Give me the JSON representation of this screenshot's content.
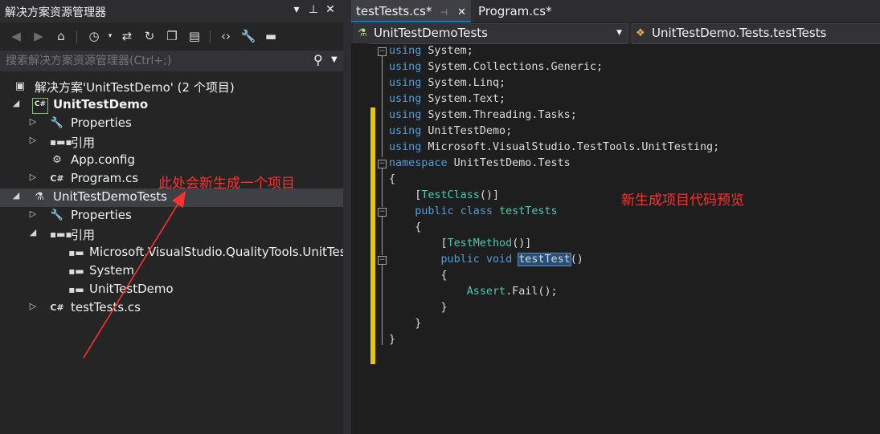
{
  "solution_explorer": {
    "title": "解决方案资源管理器",
    "title_buttons": [
      "▾",
      "⊥",
      "✕"
    ],
    "search_placeholder": "搜索解决方案资源管理器(Ctrl+;)",
    "tree": [
      {
        "label": "解决方案'UnitTestDemo' (2 个项目)",
        "icon": "solution-icon"
      },
      {
        "label": "UnitTestDemo",
        "icon": "csharp-project-icon"
      },
      {
        "label": "Properties",
        "icon": "wrench-icon"
      },
      {
        "label": "引用",
        "icon": "references-icon"
      },
      {
        "label": "App.config",
        "icon": "config-file-icon"
      },
      {
        "label": "Program.cs",
        "icon": "csharp-file-icon"
      },
      {
        "label": "UnitTestDemoTests",
        "icon": "test-project-icon"
      },
      {
        "label": "Properties",
        "icon": "wrench-icon"
      },
      {
        "label": "引用",
        "icon": "references-icon"
      },
      {
        "label": "Microsoft.VisualStudio.QualityTools.UnitTestFramework",
        "icon": "reference-icon"
      },
      {
        "label": "System",
        "icon": "reference-icon"
      },
      {
        "label": "UnitTestDemo",
        "icon": "reference-icon"
      },
      {
        "label": "testTests.cs",
        "icon": "csharp-file-icon"
      }
    ]
  },
  "annotations": {
    "left": "此处会新生成一个项目",
    "right": "新生成项目代码预览",
    "accent_color": "#ff3030"
  },
  "editor": {
    "tabs": [
      {
        "label": "testTests.cs*",
        "active": true
      },
      {
        "label": "Program.cs*",
        "active": false
      }
    ],
    "nav_left": "UnitTestDemoTests",
    "nav_right": "UnitTestDemo.Tests.testTests",
    "code_lines": [
      [
        [
          "kw",
          "using"
        ],
        [
          "t",
          " System;"
        ]
      ],
      [
        [
          "kw",
          "using"
        ],
        [
          "t",
          " System.Collections.Generic;"
        ]
      ],
      [
        [
          "kw",
          "using"
        ],
        [
          "t",
          " System.Linq;"
        ]
      ],
      [
        [
          "kw",
          "using"
        ],
        [
          "t",
          " System.Text;"
        ]
      ],
      [
        [
          "kw",
          "using"
        ],
        [
          "t",
          " System.Threading.Tasks;"
        ]
      ],
      [
        [
          "kw",
          "using"
        ],
        [
          "t",
          " UnitTestDemo;"
        ]
      ],
      [
        [
          "kw",
          "using"
        ],
        [
          "t",
          " Microsoft.VisualStudio.TestTools.UnitTesting;"
        ]
      ],
      [
        [
          "kw",
          "namespace"
        ],
        [
          "t",
          " UnitTestDemo.Tests"
        ]
      ],
      [
        [
          "t",
          "{"
        ]
      ],
      [
        [
          "t",
          "    ["
        ],
        [
          "ty",
          "TestClass"
        ],
        [
          "t",
          "()]"
        ]
      ],
      [
        [
          "t",
          "    "
        ],
        [
          "kw",
          "public"
        ],
        [
          "t",
          " "
        ],
        [
          "kw",
          "class"
        ],
        [
          "t",
          " "
        ],
        [
          "ty",
          "testTests"
        ]
      ],
      [
        [
          "t",
          "    {"
        ]
      ],
      [
        [
          "t",
          "        ["
        ],
        [
          "ty",
          "TestMethod"
        ],
        [
          "t",
          "()]"
        ]
      ],
      [
        [
          "t",
          "        "
        ],
        [
          "kw",
          "public"
        ],
        [
          "t",
          " "
        ],
        [
          "kw",
          "void"
        ],
        [
          "t",
          " "
        ],
        [
          "hl",
          "testTest"
        ],
        [
          "t",
          "()"
        ]
      ],
      [
        [
          "t",
          "        {"
        ]
      ],
      [
        [
          "t",
          "            "
        ],
        [
          "ty",
          "Assert"
        ],
        [
          "t",
          ".Fail();"
        ]
      ],
      [
        [
          "t",
          "        }"
        ]
      ],
      [
        [
          "t",
          "    }"
        ]
      ],
      [
        [
          "t",
          "}"
        ]
      ]
    ]
  }
}
